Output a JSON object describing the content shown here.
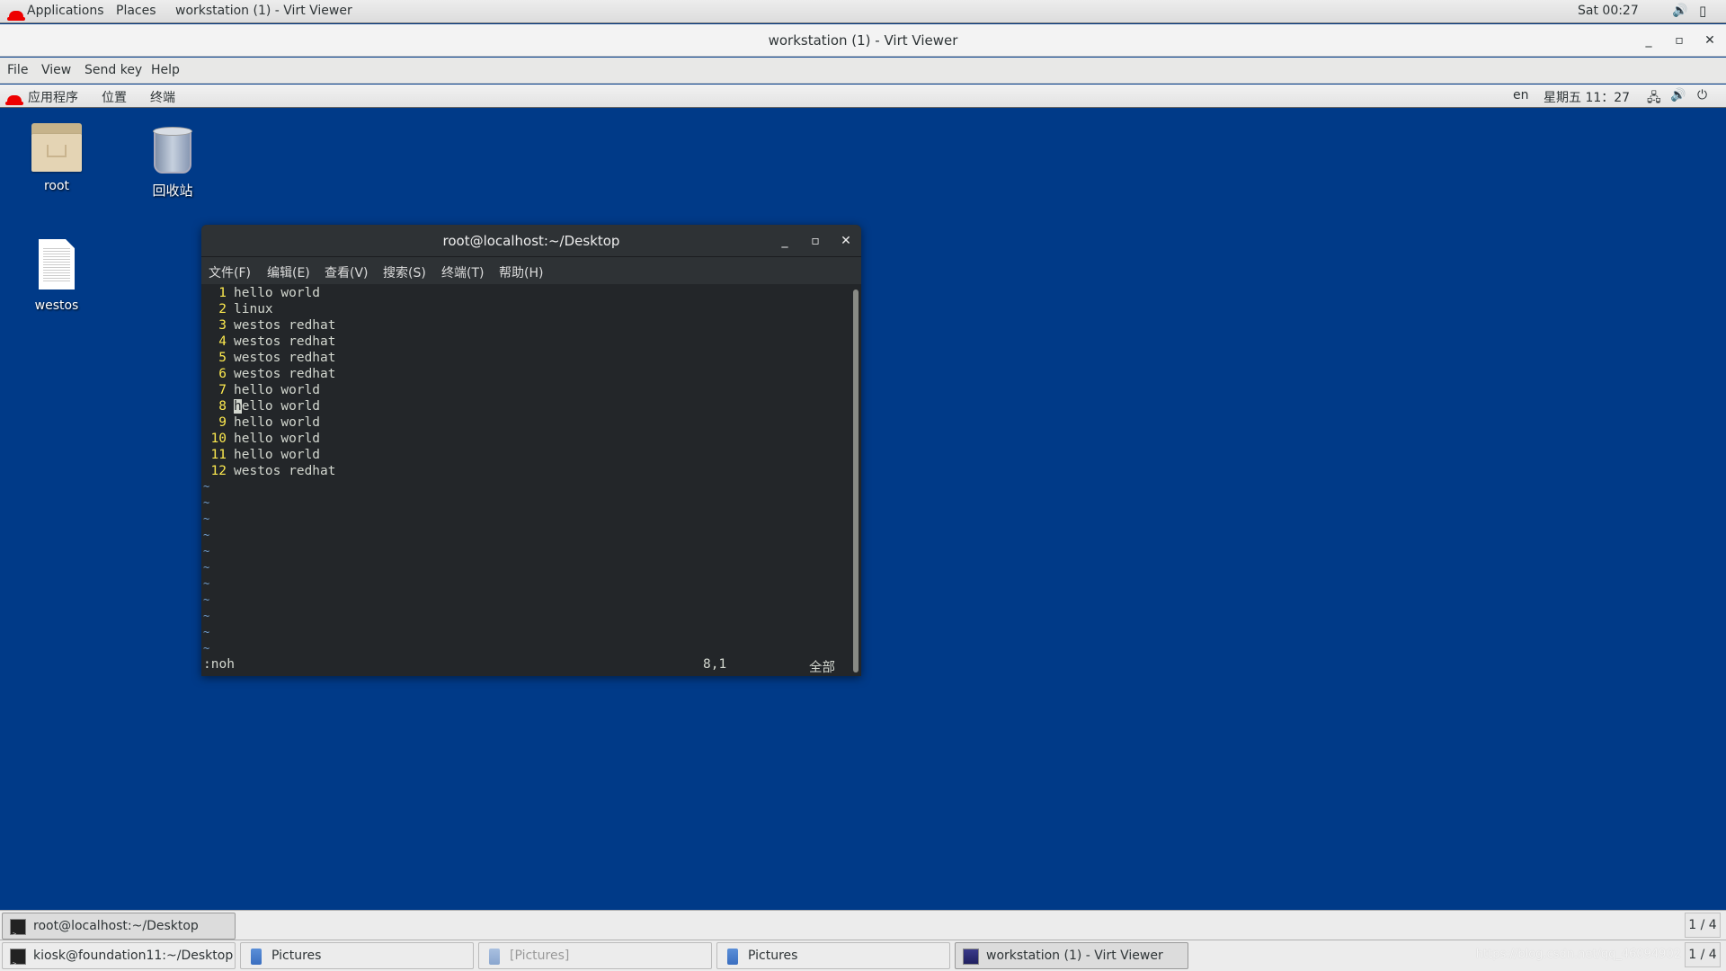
{
  "host_bar": {
    "applications": "Applications",
    "places": "Places",
    "active_window": "workstation (1) - Virt Viewer",
    "clock": "Sat 00:27",
    "icons": [
      "volume-icon",
      "battery-icon"
    ]
  },
  "virt_viewer": {
    "title": "workstation (1) - Virt Viewer",
    "menu": [
      "File",
      "View",
      "Send key",
      "Help"
    ],
    "window_controls": {
      "minimize": "_",
      "maximize": "▫",
      "close": "✕"
    }
  },
  "guest_bar": {
    "applications": "应用程序",
    "places": "位置",
    "terminal": "终端",
    "lang": "en",
    "clock": "星期五 11：27",
    "icons": [
      "network-icon",
      "volume-icon",
      "power-icon"
    ]
  },
  "desktop": {
    "icons": [
      {
        "label": "root",
        "type": "home-folder"
      },
      {
        "label": "回收站",
        "type": "trash"
      },
      {
        "label": "westos",
        "type": "text-file"
      }
    ]
  },
  "terminal": {
    "title": "root@localhost:~/Desktop",
    "menu": [
      "文件(F)",
      "编辑(E)",
      "查看(V)",
      "搜索(S)",
      "终端(T)",
      "帮助(H)"
    ],
    "lines": [
      {
        "num": "1",
        "text": "hello world"
      },
      {
        "num": "2",
        "text": "linux"
      },
      {
        "num": "3",
        "text": "westos redhat"
      },
      {
        "num": "4",
        "text": "westos redhat"
      },
      {
        "num": "5",
        "text": "westos redhat"
      },
      {
        "num": "6",
        "text": "westos redhat"
      },
      {
        "num": "7",
        "text": "hello world"
      },
      {
        "num": "8",
        "text": "hello world"
      },
      {
        "num": "9",
        "text": "hello world"
      },
      {
        "num": "10",
        "text": "hello world"
      },
      {
        "num": "11",
        "text": "hello world"
      },
      {
        "num": "12",
        "text": "westos redhat"
      }
    ],
    "cursor_line": 8,
    "tilde": "~",
    "command": ":noh",
    "position": "8,1",
    "scroll_status": "全部"
  },
  "panel_top": {
    "tasks": [
      {
        "label": "root@localhost:~/Desktop",
        "icon": "terminal-icon"
      }
    ],
    "pager": "1 / 4"
  },
  "panel_bottom": {
    "tasks": [
      {
        "label": "kiosk@foundation11:~/Desktop",
        "icon": "terminal-icon"
      },
      {
        "label": "Pictures",
        "icon": "file-manager-icon"
      },
      {
        "label": "[Pictures]",
        "icon": "file-manager-icon"
      },
      {
        "label": "Pictures",
        "icon": "file-manager-icon"
      },
      {
        "label": "workstation (1) - Virt Viewer",
        "icon": "virt-viewer-icon"
      }
    ],
    "watermark": "https://blog.csdn.net/qq_46094902",
    "pager": "1 / 4"
  }
}
